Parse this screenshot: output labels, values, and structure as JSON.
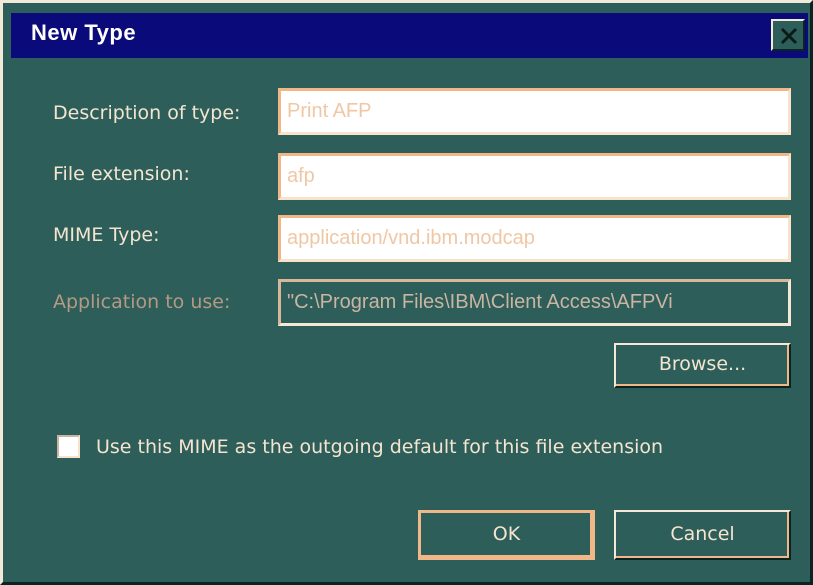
{
  "dialog": {
    "title": "New Type",
    "close_label": "Close"
  },
  "form": {
    "description_label": "Description of type:",
    "description_value": "Print AFP",
    "extension_label": "File extension:",
    "extension_value": "afp",
    "mime_label": "MIME Type:",
    "mime_value": "application/vnd.ibm.modcap",
    "application_label": "Application to use:",
    "application_value": "\"C:\\Program Files\\IBM\\Client Access\\AFPVi"
  },
  "buttons": {
    "browse_label": "Browse...",
    "ok_label": "OK",
    "cancel_label": "Cancel"
  },
  "checkbox": {
    "label": "Use this MIME as the outgoing default for this file extension",
    "checked": false
  },
  "colors": {
    "face": "#2e5e5a",
    "titlebar": "#0a0a7a",
    "text": "#f3e5cf",
    "field_text": "#f0c7a4",
    "highlight": "#f0b889"
  }
}
